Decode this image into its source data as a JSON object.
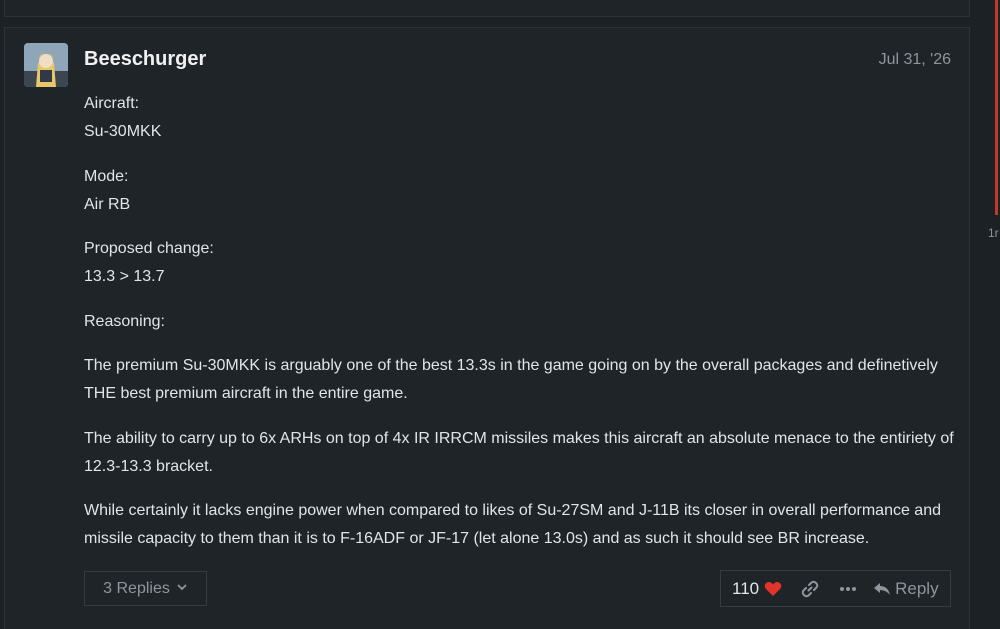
{
  "post": {
    "username": "Beeschurger",
    "date": "Jul 31, '26",
    "paragraphs": [
      "Aircraft:\nSu-30MKK",
      "Mode:\nAir RB",
      "Proposed change:\n13.3 > 13.7",
      "Reasoning:",
      "The premium Su-30MKK is arguably one of the best 13.3s in the game going on by the overall packages and definetively THE best premium aircraft in the entire game.",
      "The ability to carry up to 6x ARHs on top of 4x IR IRRCM missiles makes this aircraft an absolute menace to the entiriety of 12.3-13.3 bracket.",
      "While certainly it lacks engine power when compared to likes of Su-27SM and J-11B its closer in overall performance and missile capacity to them than it is to F-16ADF or JF-17 (let alone 13.0s) and as such it should see BR increase."
    ],
    "replies_label": "3 Replies",
    "like_count": "110",
    "reply_label": "Reply"
  },
  "timeline": {
    "label": "1r"
  },
  "icons": {
    "heart": "heart-icon",
    "link": "link-icon",
    "more": "ellipsis-icon",
    "reply": "reply-arrow-icon",
    "chevron": "chevron-down-icon"
  },
  "colors": {
    "background": "#1c2126",
    "heart": "#e0342c",
    "muted": "#8e959c",
    "timeline_bar": "#c0392b"
  }
}
